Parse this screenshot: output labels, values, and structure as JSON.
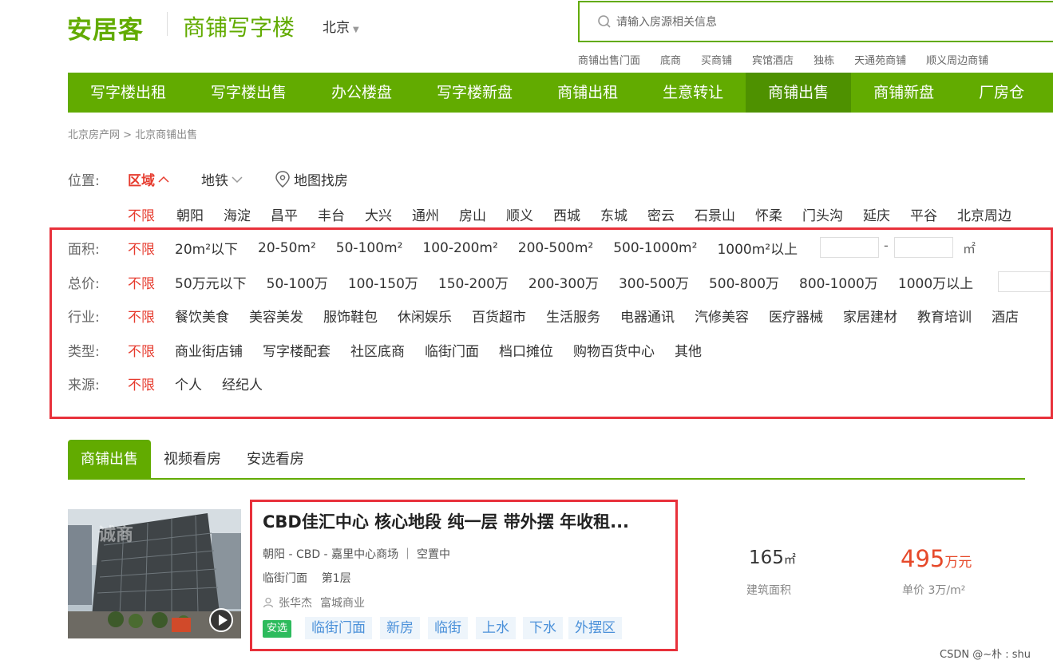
{
  "header": {
    "logo": "安居客",
    "site_name": "商铺写字楼",
    "city": "北京",
    "search_placeholder": "请输入房源相关信息",
    "hot_words": [
      "商铺出售门面",
      "底商",
      "买商铺",
      "宾馆酒店",
      "独栋",
      "天通苑商铺",
      "顺义周边商铺"
    ]
  },
  "nav": {
    "items": [
      "写字楼出租",
      "写字楼出售",
      "办公楼盘",
      "写字楼新盘",
      "商铺出租",
      "生意转让",
      "商铺出售",
      "商铺新盘",
      "厂房仓"
    ],
    "active_index": 6
  },
  "breadcrumb": "北京房产网 > 北京商铺出售",
  "filters": {
    "location": {
      "label": "位置:",
      "tabs": [
        "区域",
        "地铁",
        "地图找房"
      ],
      "districts": [
        "不限",
        "朝阳",
        "海淀",
        "昌平",
        "丰台",
        "大兴",
        "通州",
        "房山",
        "顺义",
        "西城",
        "东城",
        "密云",
        "石景山",
        "怀柔",
        "门头沟",
        "延庆",
        "平谷",
        "北京周边"
      ]
    },
    "area": {
      "label": "面积:",
      "options": [
        "不限",
        "20m²以下",
        "20-50m²",
        "50-100m²",
        "100-200m²",
        "200-500m²",
        "500-1000m²",
        "1000m²以上"
      ],
      "range_sep": "-",
      "unit": "㎡"
    },
    "price": {
      "label": "总价:",
      "options": [
        "不限",
        "50万元以下",
        "50-100万",
        "100-150万",
        "150-200万",
        "200-300万",
        "300-500万",
        "500-800万",
        "800-1000万",
        "1000万以上"
      ]
    },
    "industry": {
      "label": "行业:",
      "options": [
        "不限",
        "餐饮美食",
        "美容美发",
        "服饰鞋包",
        "休闲娱乐",
        "百货超市",
        "生活服务",
        "电器通讯",
        "汽修美容",
        "医疗器械",
        "家居建材",
        "教育培训",
        "酒店"
      ]
    },
    "type": {
      "label": "类型:",
      "options": [
        "不限",
        "商业街店铺",
        "写字楼配套",
        "社区底商",
        "临街门面",
        "档口摊位",
        "购物百货中心",
        "其他"
      ]
    },
    "source": {
      "label": "来源:",
      "options": [
        "不限",
        "个人",
        "经纪人"
      ]
    }
  },
  "list_tabs": [
    "商铺出售",
    "视频看房",
    "安选看房"
  ],
  "listing": {
    "title": "CBD佳汇中心 核心地段 纯一层 带外摆 年收租...",
    "location_line": "朝阳 - CBD - 嘉里中心商场 ｜ 空置中",
    "type_line": "临街门面    第1层",
    "agent": "张华杰",
    "agency": "富城商业",
    "badge": "安选",
    "tags": [
      "临街门面",
      "新房",
      "临街",
      "上水",
      "下水",
      "外摆区"
    ],
    "area_value": "165",
    "area_unit": "㎡",
    "area_label": "建筑面积",
    "price_value": "495",
    "price_unit": "万元",
    "unit_price": "单价 3万/m²",
    "thumb_text": "诚商"
  },
  "watermark": "CSDN @~朴 : shu",
  "colors": {
    "brand": "#62ab00",
    "selected": "#e63c2f",
    "highlight_box": "#e8313b",
    "price": "#e6492a"
  }
}
